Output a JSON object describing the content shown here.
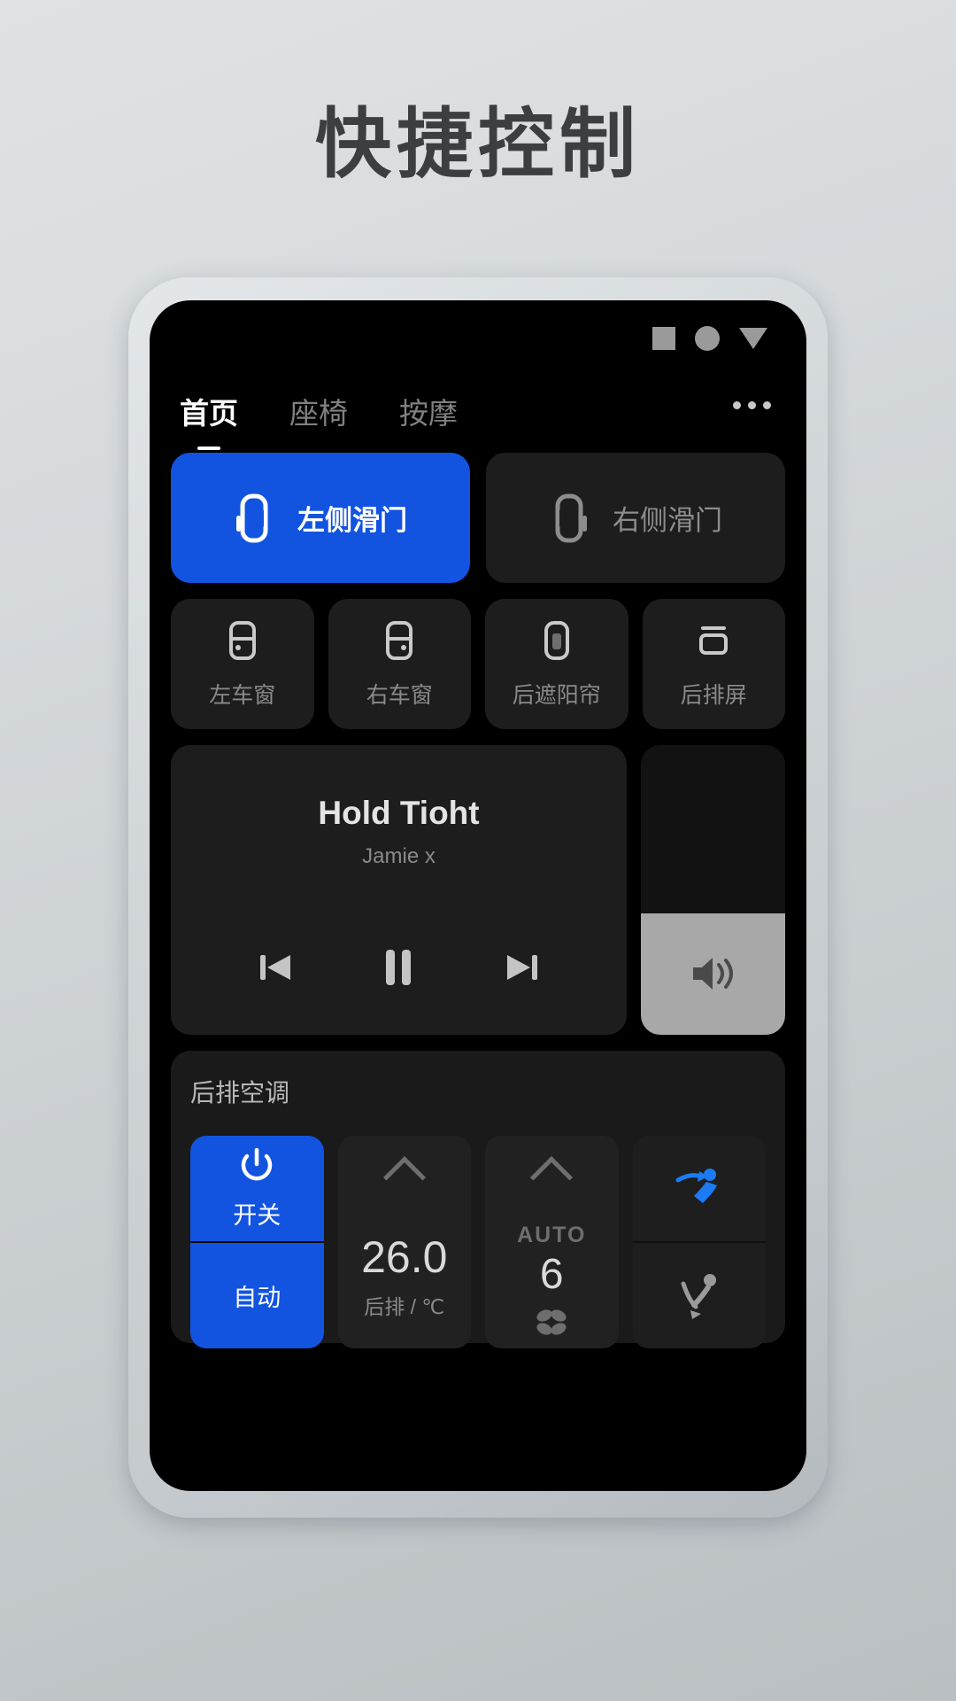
{
  "page": {
    "title": "快捷控制",
    "title_color": "#3c3f41",
    "background_colors": [
      "#dfe3e5",
      "#b9bfc2"
    ]
  },
  "device": {
    "bezel_color": "#d2d7da",
    "screen_color": "#000000"
  },
  "statusbar": {
    "icons": [
      "square-icon",
      "circle-icon",
      "triangle-down-icon"
    ],
    "icon_color": "#9a9a9a"
  },
  "tabs": [
    {
      "label": "首页",
      "active": true
    },
    {
      "label": "座椅",
      "active": false
    },
    {
      "label": "按摩",
      "active": false
    }
  ],
  "overflow_menu": {
    "name": "more-options",
    "glyph": "•••"
  },
  "accent": {
    "blue": "#1254e0",
    "card": "#1d1d1d",
    "muted_text": "#8a8a8a"
  },
  "doors": [
    {
      "label": "左侧滑门",
      "icon": "left-sliding-door-icon",
      "active": true
    },
    {
      "label": "右侧滑门",
      "icon": "right-sliding-door-icon",
      "active": false
    }
  ],
  "windows": [
    {
      "label": "左车窗",
      "icon": "left-window-icon"
    },
    {
      "label": "右车窗",
      "icon": "right-window-icon"
    },
    {
      "label": "后遮阳帘",
      "icon": "rear-sunshade-icon"
    },
    {
      "label": "后排屏",
      "icon": "rear-screen-icon"
    }
  ],
  "media": {
    "track_title": "Hold Tioht",
    "artist": "Jamie x",
    "controls": [
      {
        "name": "previous-track-button",
        "icon": "skip-previous-icon"
      },
      {
        "name": "pause-button",
        "icon": "pause-icon"
      },
      {
        "name": "next-track-button",
        "icon": "skip-next-icon"
      }
    ],
    "volume": {
      "name": "volume-slider",
      "icon": "speaker-icon",
      "level_percent": 42,
      "fill_color": "#a8a8a8"
    }
  },
  "ac": {
    "title": "后排空调",
    "power": {
      "label": "开关",
      "icon": "power-icon",
      "active": true
    },
    "auto": {
      "label": "自动",
      "active": true
    },
    "temperature": {
      "value": "26.0",
      "sublabel": "后排 / ℃",
      "up_icon": "chevron-up-icon"
    },
    "fan": {
      "mode_label": "AUTO",
      "value": "6",
      "up_icon": "chevron-up-icon",
      "icon": "fan-icon"
    },
    "airflow": [
      {
        "name": "airflow-face-icon",
        "active": true
      },
      {
        "name": "airflow-feet-icon",
        "active": false
      }
    ]
  }
}
